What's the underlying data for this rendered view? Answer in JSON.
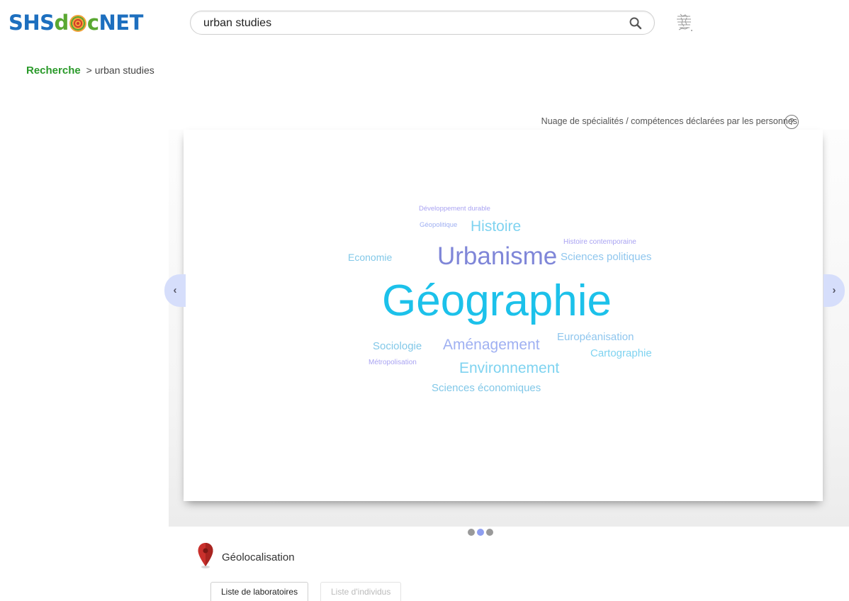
{
  "brand": {
    "part1": "SHS",
    "part2": "d",
    "part3": "c",
    "part4": "NET"
  },
  "search": {
    "value": "urban studies",
    "placeholder": ""
  },
  "breadcrumb": {
    "root": "Recherche",
    "separator": ">",
    "current": "urban studies"
  },
  "cloud": {
    "title": "Nuage de spécialités / compétences déclarées par les personnes",
    "help_symbol": "?",
    "words": [
      {
        "text": "Développement durable",
        "color": "#a9a3f2"
      },
      {
        "text": "Géopolitique",
        "color": "#9fb0f2"
      },
      {
        "text": "Histoire",
        "color": "#7fd3f0"
      },
      {
        "text": "Histoire contemporaine",
        "color": "#a9a3f2"
      },
      {
        "text": "Economie",
        "color": "#82c8e8"
      },
      {
        "text": "Urbanisme",
        "color": "#7f86d8"
      },
      {
        "text": "Sciences politiques",
        "color": "#8fc6ee"
      },
      {
        "text": "Géographie",
        "color": "#1cc1ea"
      },
      {
        "text": "Européanisation",
        "color": "#8fc6ee"
      },
      {
        "text": "Sociologie",
        "color": "#82c8e8"
      },
      {
        "text": "Aménagement",
        "color": "#9fb0f2"
      },
      {
        "text": "Cartographie",
        "color": "#7fd3f0"
      },
      {
        "text": "Métropolisation",
        "color": "#a9a3f2"
      },
      {
        "text": "Environnement",
        "color": "#7fd3f0"
      },
      {
        "text": "Sciences économiques",
        "color": "#82c8e8"
      }
    ]
  },
  "carousel": {
    "prev": "‹",
    "next": "›",
    "dots": 3,
    "active_dot": 2
  },
  "geo": {
    "label": "Géolocalisation"
  },
  "tabs": [
    {
      "label": "Liste de laboratoires",
      "active": true
    },
    {
      "label": "Liste d'individus",
      "active": false
    }
  ]
}
